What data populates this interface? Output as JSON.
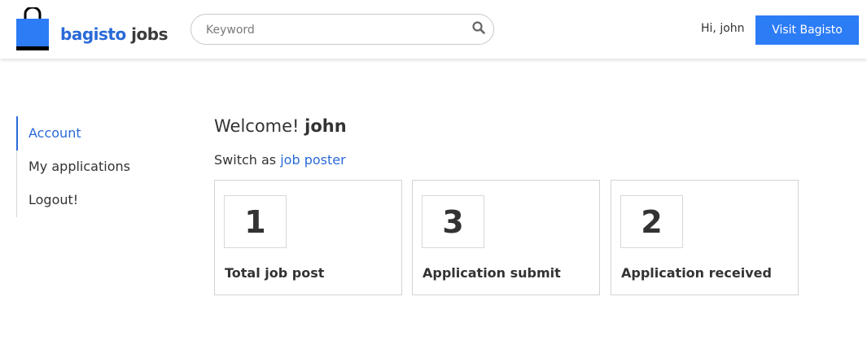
{
  "header": {
    "logo": {
      "brand": "bagisto",
      "product": "jobs"
    },
    "search": {
      "placeholder": "Keyword",
      "value": ""
    },
    "greeting": "Hi, john",
    "visit_button": "Visit Bagisto"
  },
  "sidebar": {
    "items": [
      {
        "label": "Account",
        "active": true
      },
      {
        "label": "My applications",
        "active": false
      },
      {
        "label": "Logout!",
        "active": false
      }
    ]
  },
  "main": {
    "welcome_prefix": "Welcome!",
    "user_name": "john",
    "switch_prefix": "Switch as",
    "switch_link": "job poster",
    "stats": [
      {
        "value": "1",
        "label": "Total job post"
      },
      {
        "value": "3",
        "label": "Application submit"
      },
      {
        "value": "2",
        "label": "Application received"
      }
    ]
  },
  "colors": {
    "accent": "#2a6ad8",
    "button": "#2c7cf6",
    "text": "#333333"
  }
}
